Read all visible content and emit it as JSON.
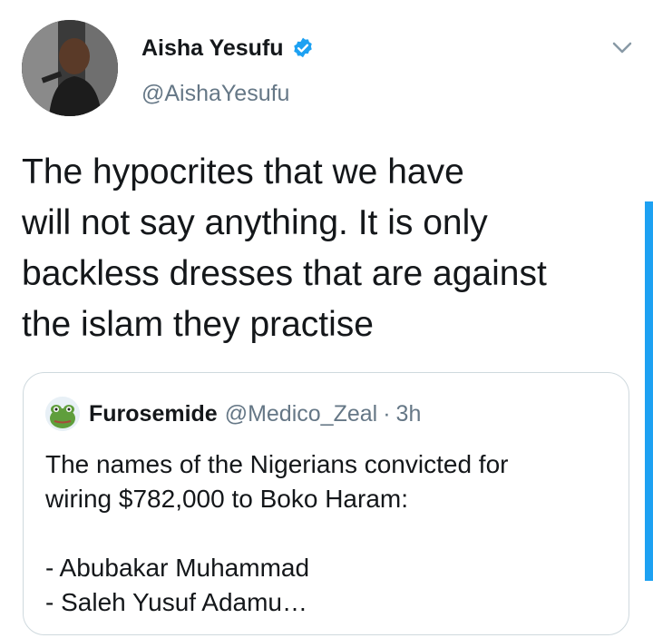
{
  "author": {
    "name": "Aisha Yesufu",
    "handle": "@AishaYesufu",
    "verified": true,
    "avatar_icon": "profile-photo"
  },
  "tweet": {
    "text": "The hypocrites that we have\nwill not say anything. It is only\nbackless dresses that are against\nthe islam they practise"
  },
  "quoted_tweet": {
    "author_name": "Furosemide",
    "author_handle": "@Medico_Zeal",
    "separator": "·",
    "time": "3h",
    "text": "The names of the Nigerians convicted for\nwiring $782,000 to Boko Haram:\n\n- Abubakar Muhammad\n- Saleh Yusuf Adamu…"
  },
  "colors": {
    "accent": "#1da1f2",
    "secondary_text": "#657786",
    "border": "#cfd9de"
  }
}
